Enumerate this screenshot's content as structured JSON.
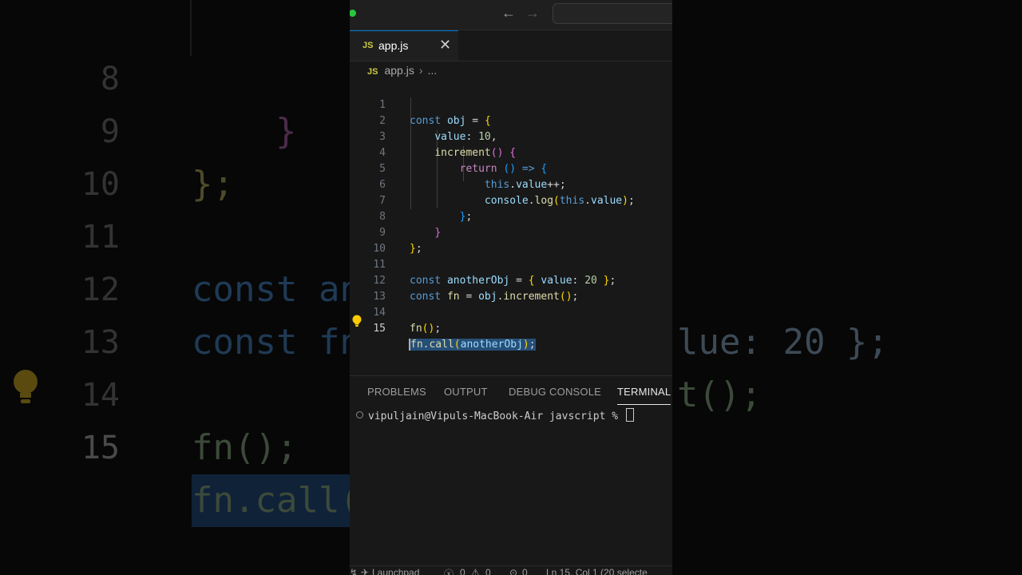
{
  "window": {
    "back_icon": "arrow-left-icon",
    "forward_icon": "arrow-right-icon"
  },
  "tab": {
    "icon_label": "JS",
    "name": "app.js",
    "close_icon": "close-icon"
  },
  "breadcrumb": {
    "icon_label": "JS",
    "file": "app.js",
    "separator": "›",
    "more": "..."
  },
  "editor": {
    "active_line": 15,
    "line_numbers": [
      "1",
      "2",
      "3",
      "4",
      "5",
      "6",
      "7",
      "8",
      "9",
      "10",
      "11",
      "12",
      "13",
      "14",
      "15"
    ],
    "lines": [
      "const obj = {",
      "    value: 10,",
      "    increment() {",
      "        return () => {",
      "            this.value++;",
      "            console.log(this.value);",
      "        };",
      "    }",
      "};",
      "",
      "const anotherObj = { value: 20 };",
      "const fn = obj.increment();",
      "",
      "fn();",
      "fn.call(anotherObj);"
    ],
    "selected_text": "fn.call(anotherObj);",
    "code_action_icon": "lightbulb-icon"
  },
  "background_zoom": {
    "line_numbers": [
      "8",
      "9",
      "10",
      "11",
      "12",
      "13",
      "14",
      "15"
    ],
    "left_fragments": [
      "}",
      "};",
      "",
      "const an",
      "const fn",
      "",
      "fn();",
      "fn.call("
    ],
    "right_fragments": [
      "",
      "",
      "",
      "lue: 20 };",
      "t();",
      "",
      "",
      ""
    ]
  },
  "panel": {
    "tabs": [
      "PROBLEMS",
      "OUTPUT",
      "DEBUG CONSOLE",
      "TERMINAL"
    ],
    "active_tab": "TERMINAL",
    "terminal_prompt": "vipuljain@Vipuls-MacBook-Air javscript % "
  },
  "statusbar": {
    "launchpad": "Launchpad",
    "errors": "0",
    "warnings": "0",
    "ports": "0",
    "position": "Ln 15, Col 1 (20 selecte"
  },
  "colors": {
    "accent": "#0078d4",
    "selection": "#264f78",
    "keyword": "#569cd6",
    "variable": "#9cdcfe",
    "function": "#dcdcaa",
    "number": "#b5cea8"
  }
}
